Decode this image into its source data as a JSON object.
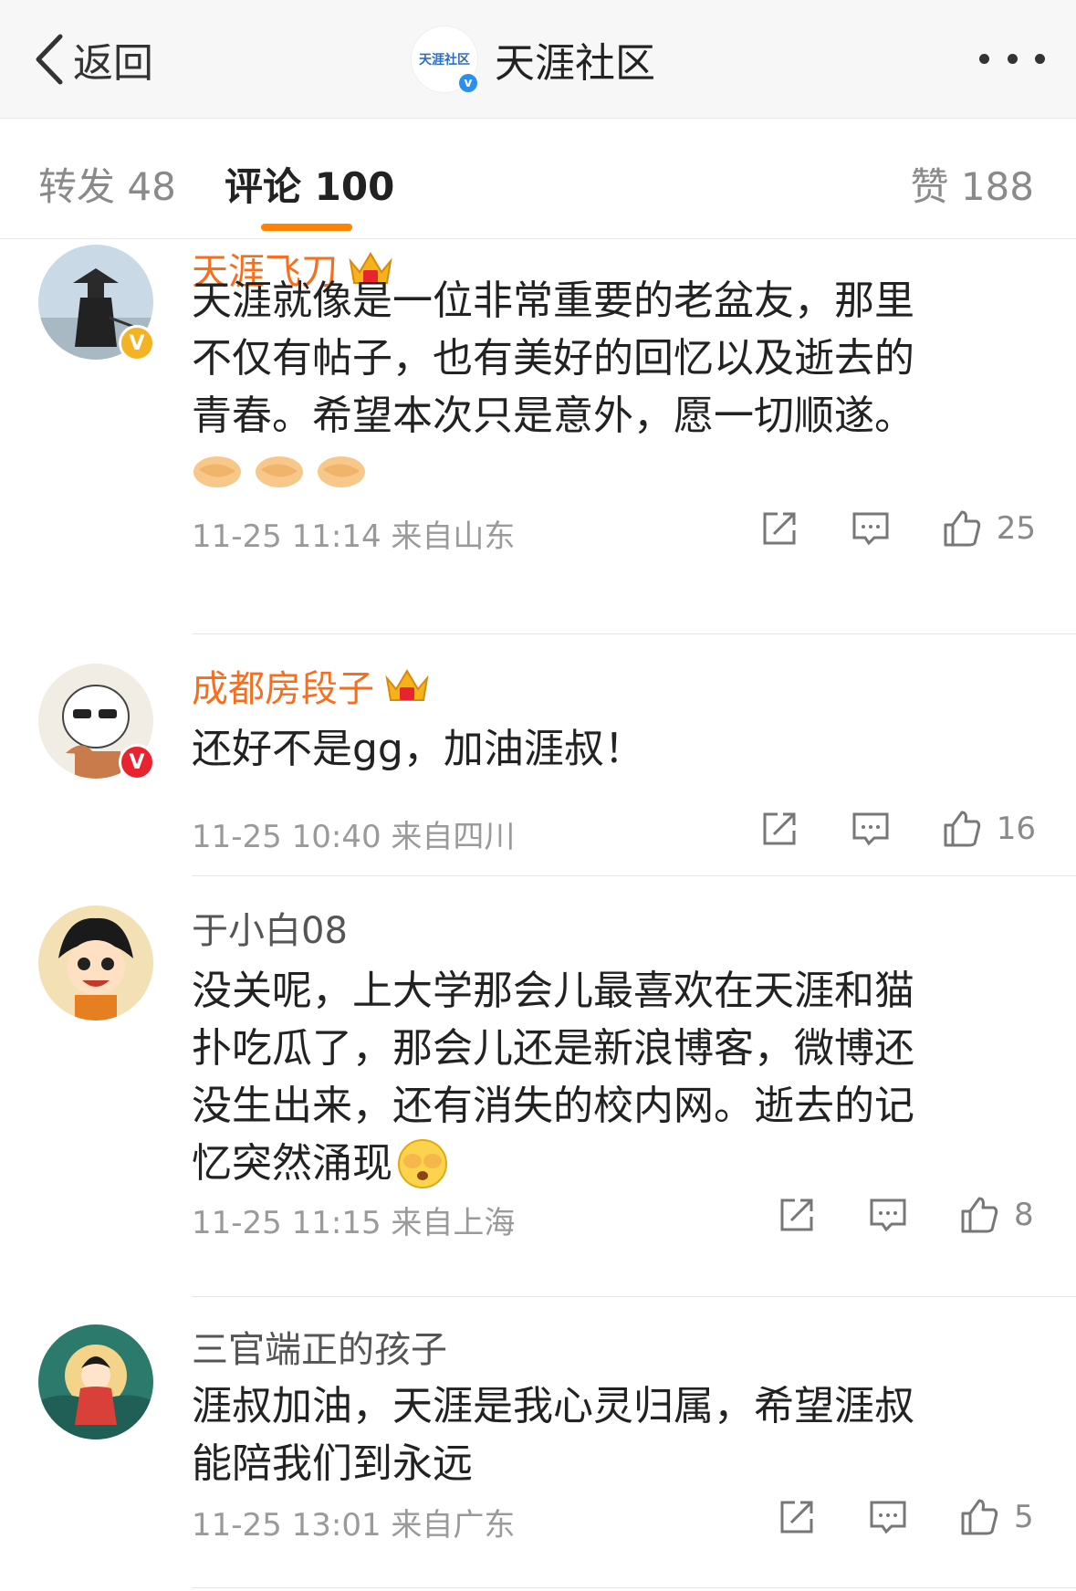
{
  "header": {
    "back_label": "返回",
    "logo_text": "天涯社区",
    "title": "天涯社区"
  },
  "tabs": {
    "repost": "转发 48",
    "comments": "评论 100",
    "likes": "赞 188"
  },
  "comments": [
    {
      "username": "天涯飞刀",
      "badge": "V",
      "text_lines": [
        "天涯就像是一位非常重要的老盆友，那里",
        "不仅有帖子，也有美好的回忆以及逝去的",
        "青春。希望本次只是意外，愿一切顺遂。"
      ],
      "emojis": [
        "handshake",
        "handshake",
        "handshake"
      ],
      "meta": "11-25 11:14  来自山东",
      "likes": "25"
    },
    {
      "username": "成都房段子",
      "badge": "V",
      "text_lines": [
        "还好不是gg，加油涯叔！"
      ],
      "meta": "11-25 10:40  来自四川",
      "likes": "16"
    },
    {
      "username": "于小白08",
      "text_lines": [
        "没关呢，上大学那会儿最喜欢在天涯和猫",
        "扑吃瓜了，那会儿还是新浪博客，微博还",
        "没生出来，还有消失的校内网。逝去的记",
        "忆突然涌现"
      ],
      "meta": "11-25 11:15  来自上海",
      "likes": "8"
    },
    {
      "username": "三官端正的孩子",
      "text_lines": [
        "涯叔加油，天涯是我心灵归属，希望涯叔",
        "能陪我们到永远"
      ],
      "meta": "11-25 13:01  来自广东",
      "likes": "5"
    }
  ],
  "colors": {
    "accent": "#ff8200",
    "vip_name": "#f86e1e",
    "meta": "#9a9a9a"
  }
}
